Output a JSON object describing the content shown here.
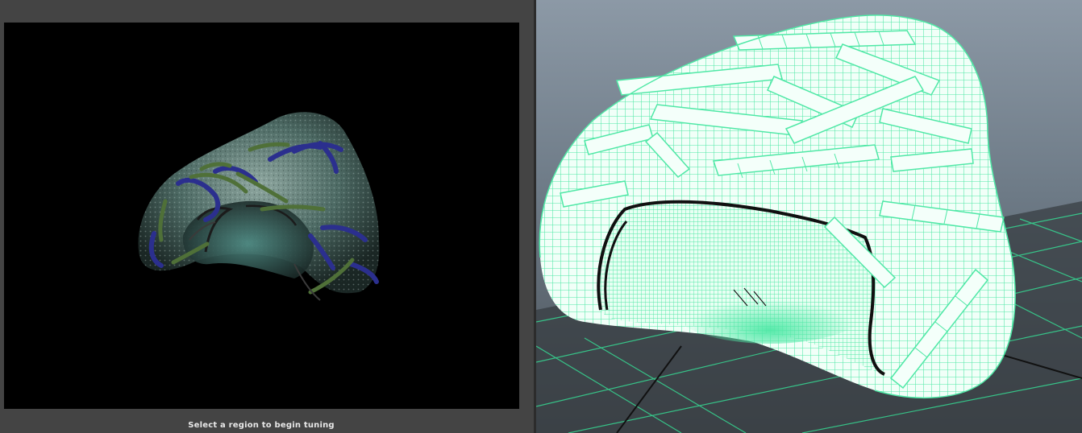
{
  "render_view": {
    "status_message": "Select a region to begin tuning"
  },
  "viewport": {
    "wireframe_color": "#4fe8a6",
    "grid_color": "#36d993",
    "shaded_color": "#f1fff8"
  }
}
